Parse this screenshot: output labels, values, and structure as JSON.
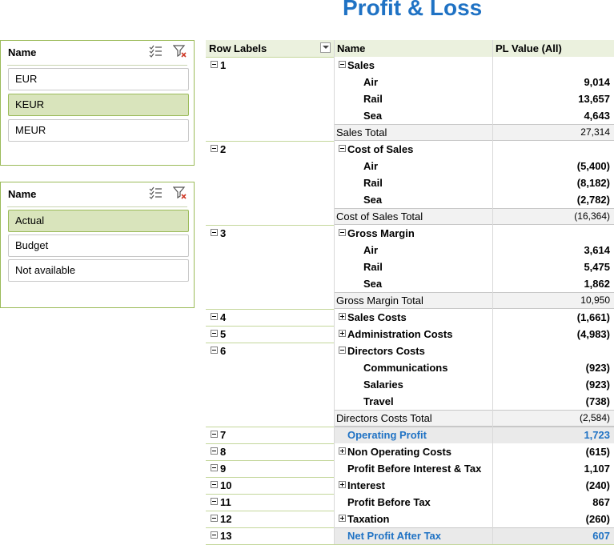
{
  "title": "Profit & Loss",
  "slicer1": {
    "header": "Name",
    "items": [
      "EUR",
      "KEUR",
      "MEUR"
    ],
    "selected": 1
  },
  "slicer2": {
    "header": "Name",
    "items": [
      "Actual",
      "Budget",
      "Not available"
    ],
    "selected": 0
  },
  "pivot": {
    "headers": {
      "row_labels": "Row Labels",
      "name": "Name",
      "value": "PL Value (All)"
    },
    "rows": [
      {
        "l": "1",
        "n": "Sales",
        "v": "",
        "t": "group"
      },
      {
        "l": "",
        "n": "Air",
        "v": "9,014",
        "t": "item"
      },
      {
        "l": "",
        "n": "Rail",
        "v": "13,657",
        "t": "item"
      },
      {
        "l": "",
        "n": "Sea",
        "v": "4,643",
        "t": "item"
      },
      {
        "l": "",
        "n": "Sales Total",
        "v": "27,314",
        "t": "total"
      },
      {
        "l": "2",
        "n": "Cost of Sales",
        "v": "",
        "t": "group"
      },
      {
        "l": "",
        "n": "Air",
        "v": "(5,400)",
        "t": "item"
      },
      {
        "l": "",
        "n": "Rail",
        "v": "(8,182)",
        "t": "item"
      },
      {
        "l": "",
        "n": "Sea",
        "v": "(2,782)",
        "t": "item"
      },
      {
        "l": "",
        "n": "Cost of Sales Total",
        "v": "(16,364)",
        "t": "total"
      },
      {
        "l": "3",
        "n": "Gross Margin",
        "v": "",
        "t": "group"
      },
      {
        "l": "",
        "n": "Air",
        "v": "3,614",
        "t": "item"
      },
      {
        "l": "",
        "n": "Rail",
        "v": "5,475",
        "t": "item"
      },
      {
        "l": "",
        "n": "Sea",
        "v": "1,862",
        "t": "item"
      },
      {
        "l": "",
        "n": "Gross Margin Total",
        "v": "10,950",
        "t": "total"
      },
      {
        "l": "4",
        "n": "Sales Costs",
        "v": "(1,661)",
        "t": "collapsed"
      },
      {
        "l": "5",
        "n": "Administration Costs",
        "v": "(4,983)",
        "t": "collapsed"
      },
      {
        "l": "6",
        "n": "Directors Costs",
        "v": "",
        "t": "group"
      },
      {
        "l": "",
        "n": "Communications",
        "v": "(923)",
        "t": "item"
      },
      {
        "l": "",
        "n": "Salaries",
        "v": "(923)",
        "t": "item"
      },
      {
        "l": "",
        "n": "Travel",
        "v": "(738)",
        "t": "item"
      },
      {
        "l": "",
        "n": "Directors Costs Total",
        "v": "(2,584)",
        "t": "total"
      },
      {
        "l": "7",
        "n": "Operating Profit",
        "v": "1,723",
        "t": "highlight"
      },
      {
        "l": "8",
        "n": "Non Operating Costs",
        "v": "(615)",
        "t": "collapsed"
      },
      {
        "l": "9",
        "n": "Profit Before Interest & Tax",
        "v": "1,107",
        "t": "plain"
      },
      {
        "l": "10",
        "n": "Interest",
        "v": "(240)",
        "t": "collapsed"
      },
      {
        "l": "11",
        "n": "Profit Before Tax",
        "v": "867",
        "t": "plain"
      },
      {
        "l": "12",
        "n": "Taxation",
        "v": "(260)",
        "t": "collapsed"
      },
      {
        "l": "13",
        "n": "Net Profit After Tax",
        "v": "607",
        "t": "highlight"
      }
    ]
  },
  "colors": {
    "accent": "#1f72c4",
    "slicer_border": "#9bbb59",
    "slicer_selected": "#d9e4bc",
    "header_bg": "#ebf1de"
  }
}
